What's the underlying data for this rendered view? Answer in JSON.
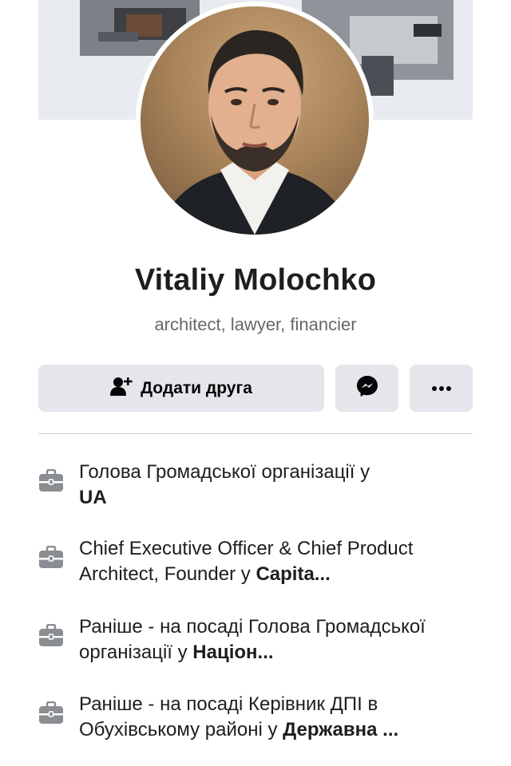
{
  "profile": {
    "name": "Vitaliy Molochko",
    "bio": "architect, lawyer, financier"
  },
  "actions": {
    "add_friend_label": "Додати друга",
    "add_friend_icon": "add-person-icon",
    "messenger_icon": "messenger-icon",
    "more_icon": "more-dots-icon"
  },
  "work": [
    {
      "prefix": "Голова Громадської організації у",
      "place": "UA",
      "icon": "briefcase-icon"
    },
    {
      "prefix": "Chief Executive Officer & Chief Product Architect, Founder у",
      "place": "Capita...",
      "icon": "briefcase-icon"
    },
    {
      "prefix": "Раніше - на посаді Голова Громадської організації у",
      "place": "Націон...",
      "icon": "briefcase-icon"
    },
    {
      "prefix": "Раніше - на посаді Керівник ДПІ в Обухівському районі у",
      "place": "Державна ...",
      "icon": "briefcase-icon"
    }
  ],
  "colors": {
    "button_bg": "#e4e6eb",
    "text_primary": "#1c1e21",
    "text_secondary": "#65676b"
  }
}
